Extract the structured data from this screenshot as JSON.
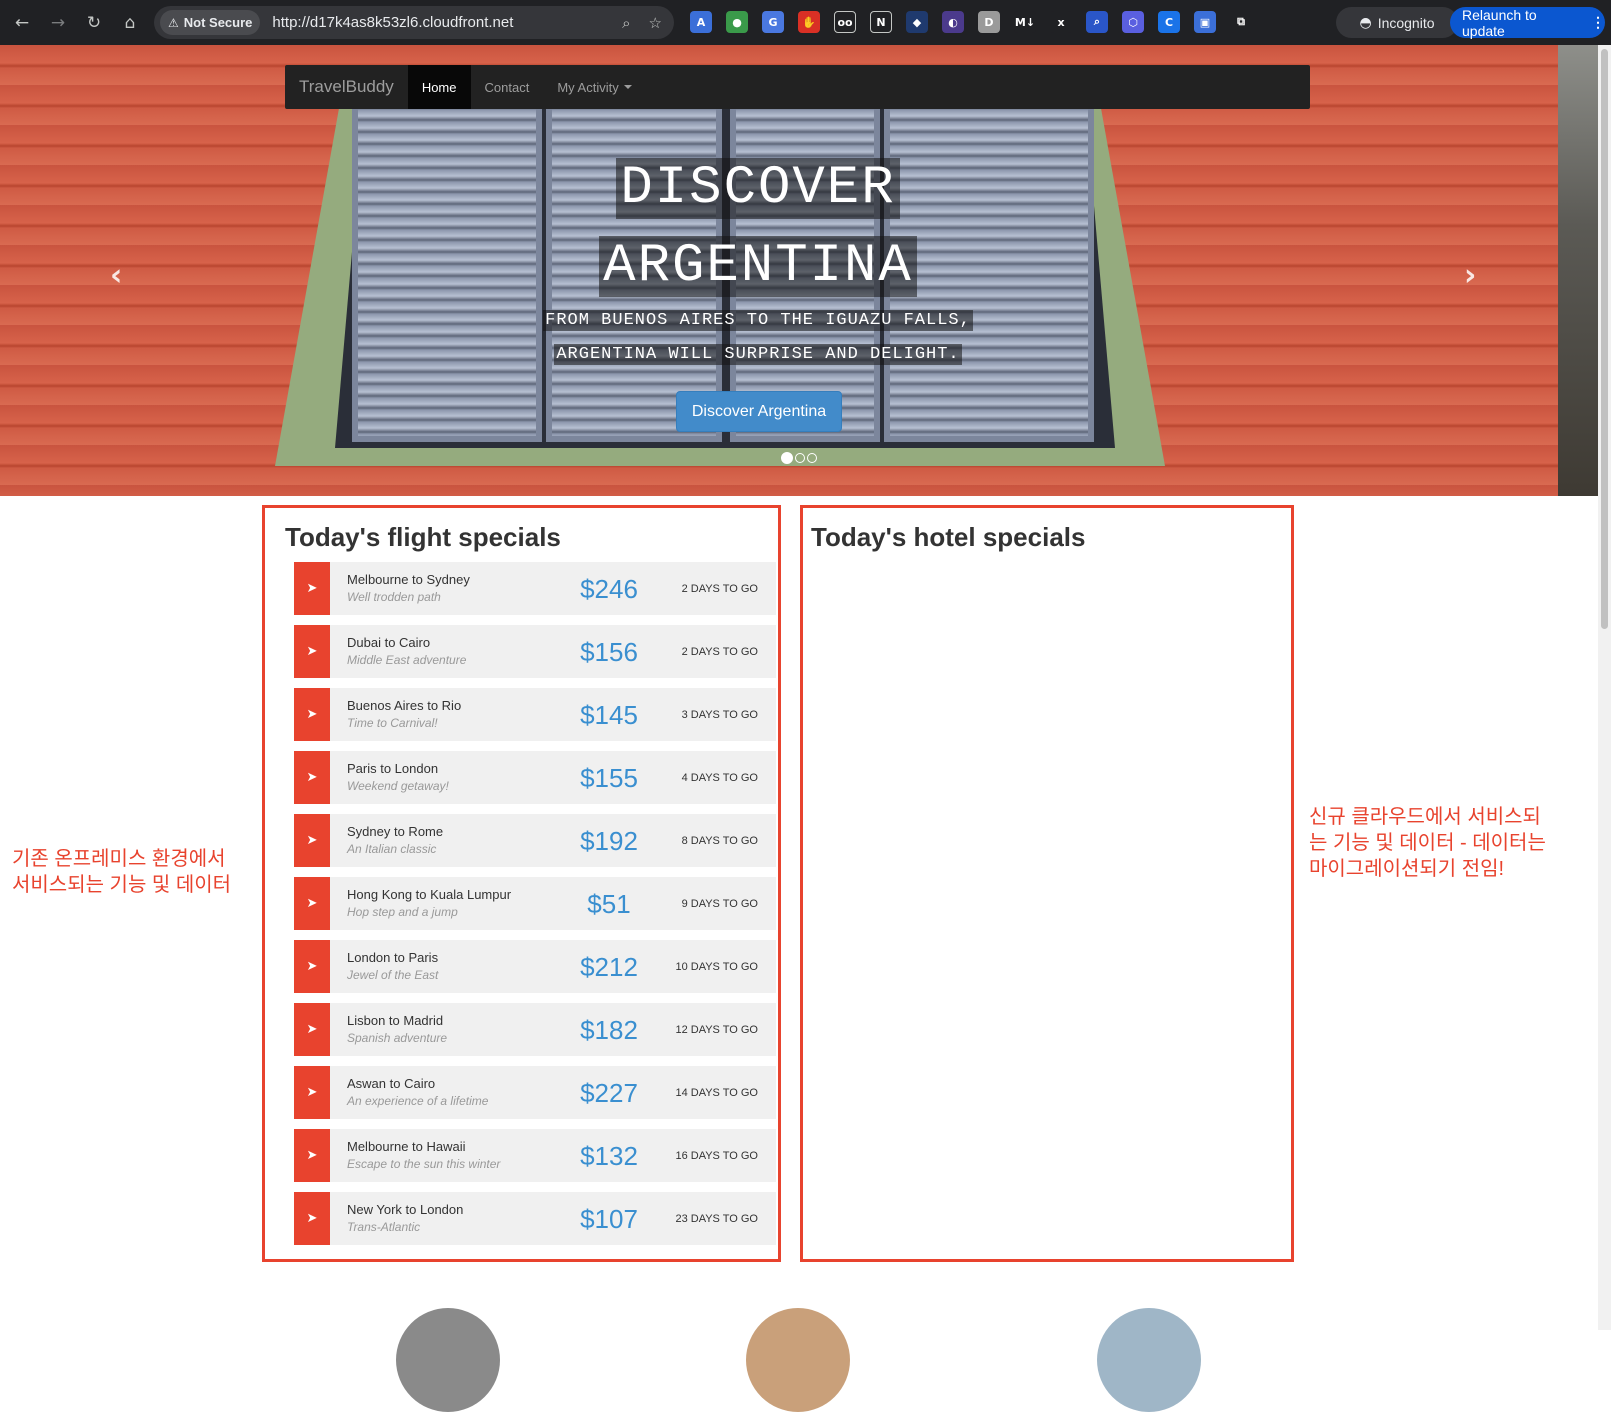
{
  "browser": {
    "security_label": "Not Secure",
    "url": "http://d17k4as8k53zl6.cloudfront.net",
    "incognito_label": "Incognito",
    "relaunch_label": "Relaunch to update"
  },
  "navbar": {
    "brand": "TravelBuddy",
    "items": [
      "Home",
      "Contact",
      "My Activity"
    ]
  },
  "hero": {
    "title_line1": "DISCOVER",
    "title_line2": "ARGENTINA",
    "subtitle_line1": "FROM BUENOS AIRES TO THE IGUAZU FALLS,",
    "subtitle_line2": "ARGENTINA WILL SURPRISE AND DELIGHT.",
    "button_label": "Discover Argentina"
  },
  "flight_specials": {
    "title": "Today's flight specials",
    "items": [
      {
        "route": "Melbourne to Sydney",
        "tagline": "Well trodden path",
        "price": "$246",
        "days": "2 DAYS TO GO"
      },
      {
        "route": "Dubai to Cairo",
        "tagline": "Middle East adventure",
        "price": "$156",
        "days": "2 DAYS TO GO"
      },
      {
        "route": "Buenos Aires to Rio",
        "tagline": "Time to Carnival!",
        "price": "$145",
        "days": "3 DAYS TO GO"
      },
      {
        "route": "Paris to London",
        "tagline": "Weekend getaway!",
        "price": "$155",
        "days": "4 DAYS TO GO"
      },
      {
        "route": "Sydney to Rome",
        "tagline": "An Italian classic",
        "price": "$192",
        "days": "8 DAYS TO GO"
      },
      {
        "route": "Hong Kong to Kuala Lumpur",
        "tagline": "Hop step and a jump",
        "price": "$51",
        "days": "9 DAYS TO GO"
      },
      {
        "route": "London to Paris",
        "tagline": "Jewel of the East",
        "price": "$212",
        "days": "10 DAYS TO GO"
      },
      {
        "route": "Lisbon to Madrid",
        "tagline": "Spanish adventure",
        "price": "$182",
        "days": "12 DAYS TO GO"
      },
      {
        "route": "Aswan to Cairo",
        "tagline": "An experience of a lifetime",
        "price": "$227",
        "days": "14 DAYS TO GO"
      },
      {
        "route": "Melbourne to Hawaii",
        "tagline": "Escape to the sun this winter",
        "price": "$132",
        "days": "16 DAYS TO GO"
      },
      {
        "route": "New York to London",
        "tagline": "Trans-Atlantic",
        "price": "$107",
        "days": "23 DAYS TO GO"
      }
    ]
  },
  "hotel_specials": {
    "title": "Today's hotel specials"
  },
  "annotations": {
    "left_line1": "기존 온프레미스 환경에서",
    "left_line2": "서비스되는 기능 및 데이터",
    "right_line1": "신규 클라우드에서 서비스되",
    "right_line2": "는 기능 및 데이터 - 데이터는",
    "right_line3": "마이그레이션되기 전임!"
  },
  "colors": {
    "accent_red": "#e8432e",
    "price_blue": "#3a8fd0",
    "button_blue": "#428bca",
    "navbar_dark": "#222222"
  },
  "icons": [
    "back-arrow-icon",
    "forward-arrow-icon",
    "reload-icon",
    "home-icon",
    "warning-icon",
    "zoom-icon",
    "star-icon",
    "plane-icon",
    "chevron-left-icon",
    "chevron-right-icon"
  ]
}
